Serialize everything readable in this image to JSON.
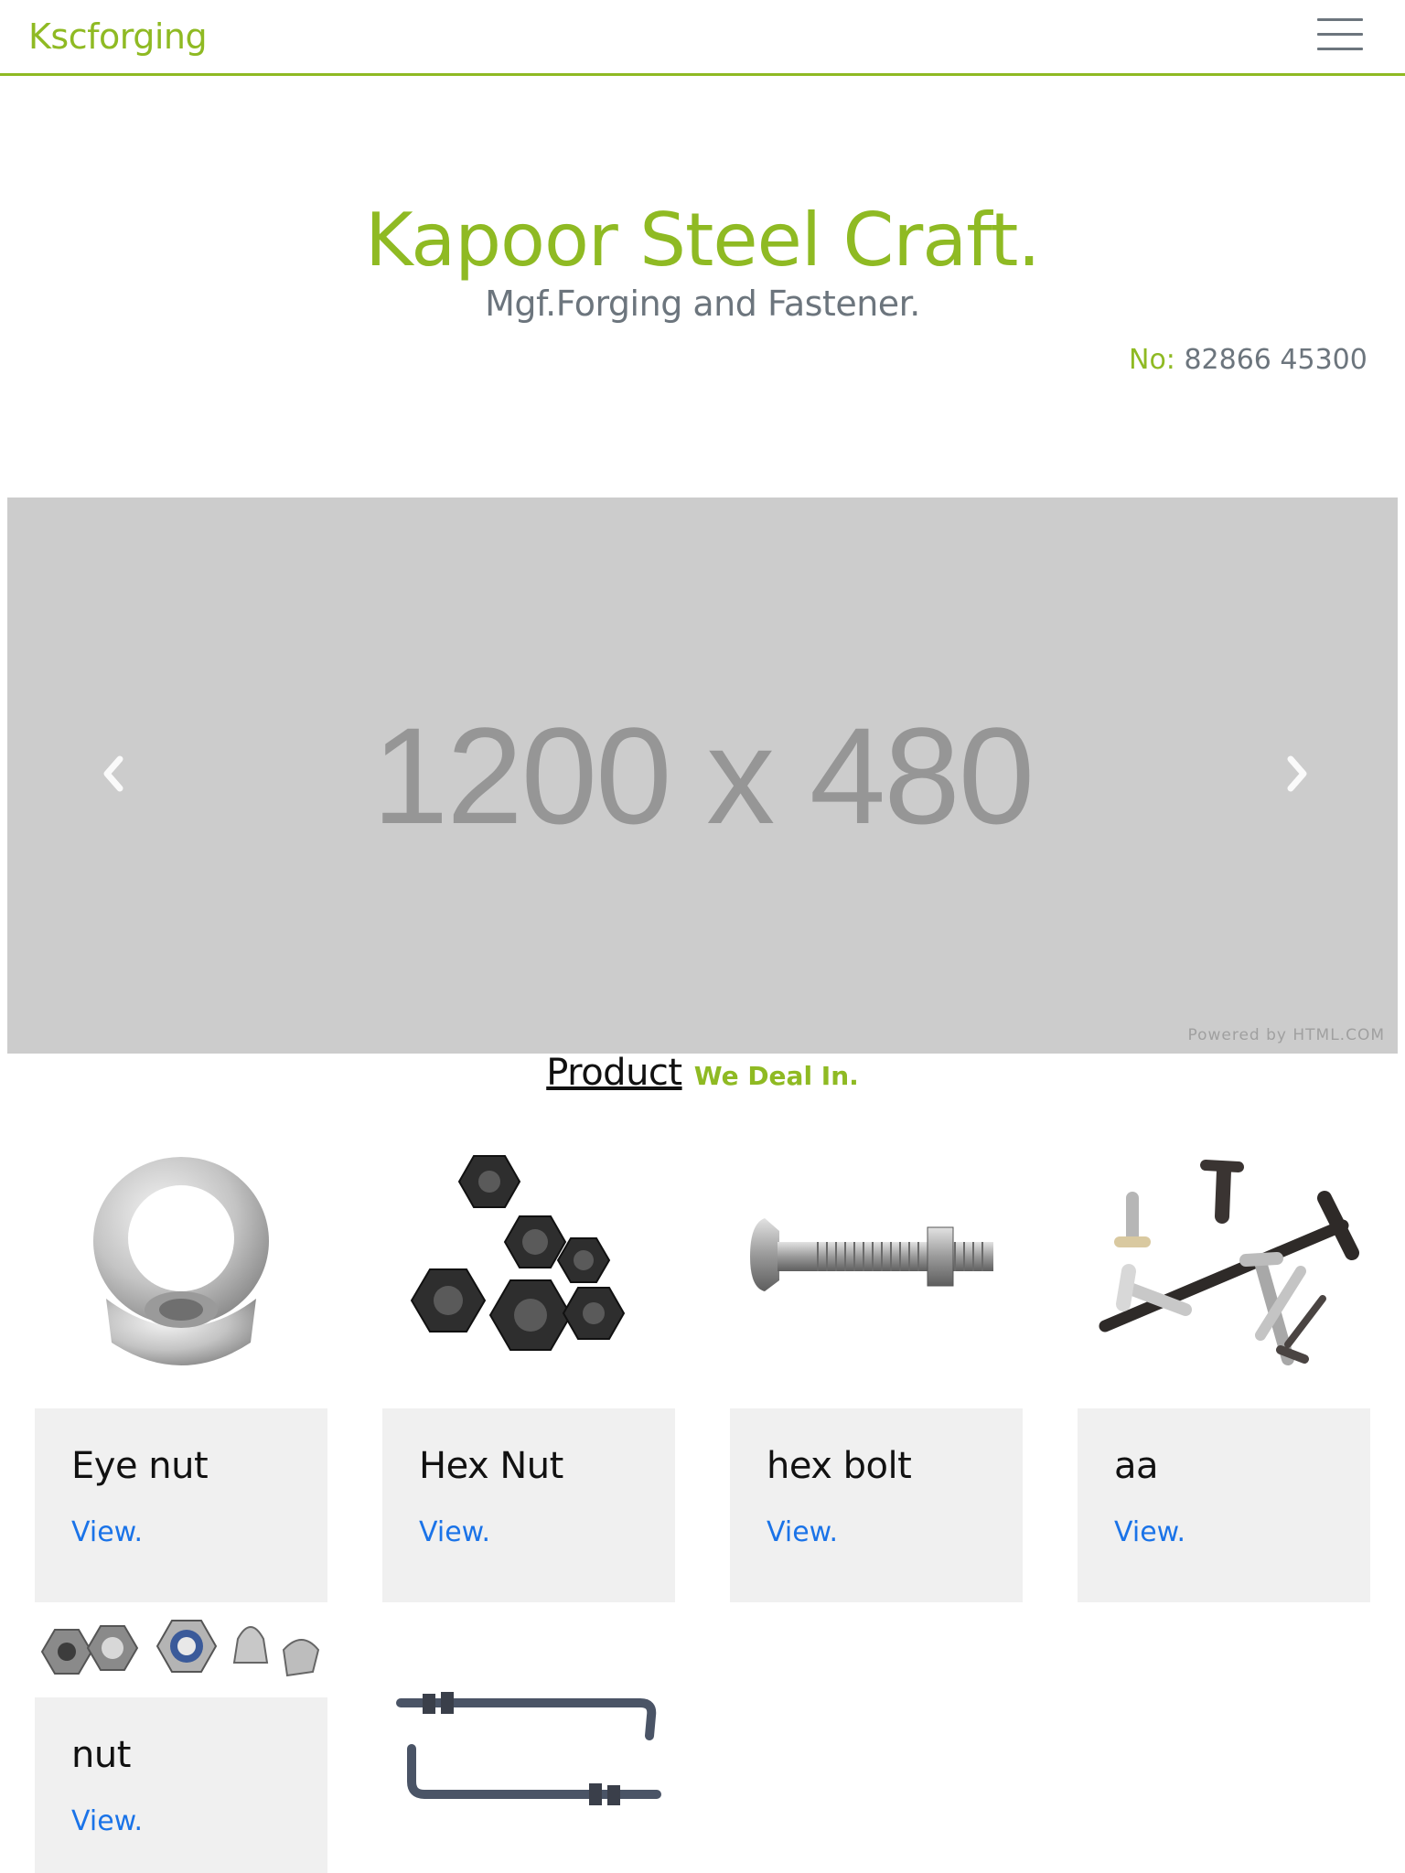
{
  "navbar": {
    "brand": "Kscforging"
  },
  "hero": {
    "title": "Kapoor Steel Craft.",
    "subtitle": "Mgf.Forging and Fastener.",
    "phone_label": "No:",
    "phone_number": "82866 45300"
  },
  "carousel": {
    "placeholder_text": "1200 x 480",
    "powered_by": "Powered by HTML.COM",
    "prev_icon": "chevron-left-icon",
    "next_icon": "chevron-right-icon"
  },
  "section": {
    "heading": "Product",
    "subheading": "We Deal In."
  },
  "products": [
    {
      "name": "Eye nut",
      "link": "View.",
      "image": "eye-nut-image"
    },
    {
      "name": "Hex Nut",
      "link": "View.",
      "image": "hex-nut-image"
    },
    {
      "name": "hex bolt",
      "link": "View.",
      "image": "hex-bolt-image"
    },
    {
      "name": "aa",
      "link": "View.",
      "image": "t-bolt-image"
    },
    {
      "name": "nut",
      "link": "View.",
      "image": "nuts-assortment-image"
    },
    {
      "name": "",
      "link": "",
      "image": "l-anchor-bolt-image"
    }
  ]
}
